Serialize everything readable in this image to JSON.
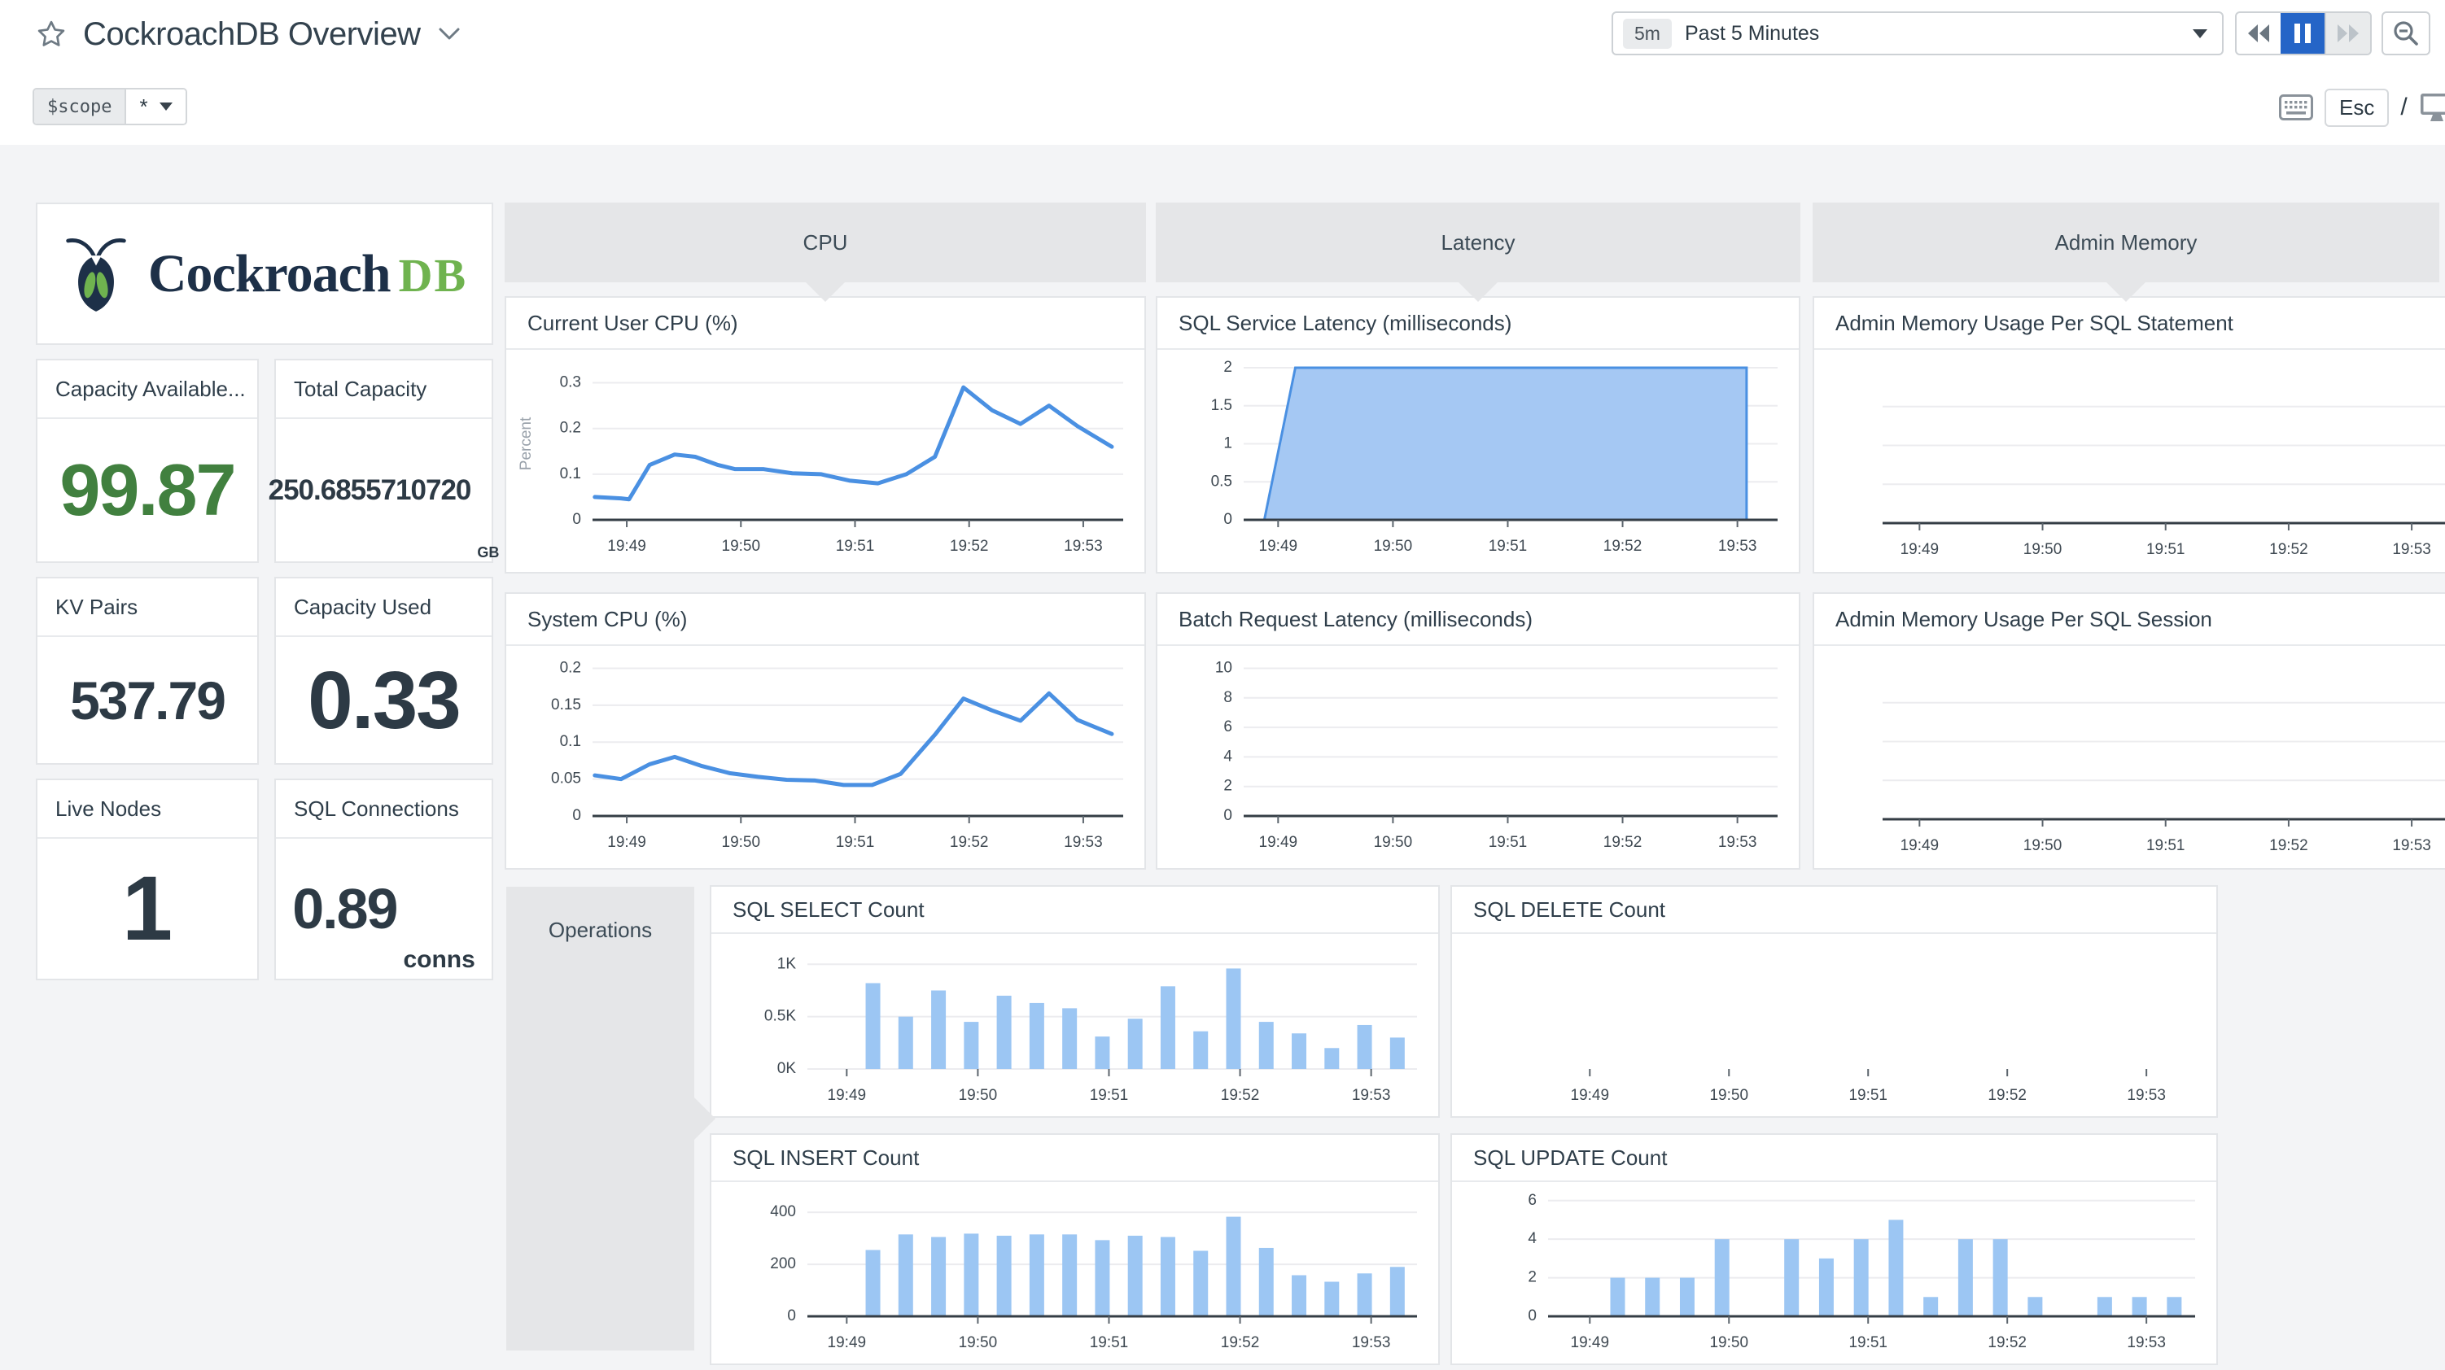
{
  "header": {
    "title": "CockroachDB Overview",
    "scope_label": "$scope",
    "scope_value": "*",
    "time_range_badge": "5m",
    "time_range_label": "Past 5 Minutes",
    "esc_label": "Esc",
    "slash": "/"
  },
  "logo": {
    "word": "Cockroach",
    "suffix": "DB"
  },
  "groups": {
    "cpu": "CPU",
    "latency": "Latency",
    "admin_memory": "Admin Memory",
    "operations": "Operations"
  },
  "metrics": [
    {
      "title": "Capacity Available...",
      "value": "99.87",
      "unit": "",
      "color": "#41803f"
    },
    {
      "title": "Total Capacity",
      "value": "250.6855710720",
      "unit": "GB",
      "color": "#2d3a45"
    },
    {
      "title": "KV Pairs",
      "value": "537.79",
      "unit": "",
      "color": "#2d3a45"
    },
    {
      "title": "Capacity Used",
      "value": "0.33",
      "unit": "",
      "color": "#2d3a45"
    },
    {
      "title": "Live Nodes",
      "value": "1",
      "unit": "",
      "color": "#2d3a45"
    },
    {
      "title": "SQL Connections",
      "value": "0.89",
      "unit": "conns",
      "color": "#2d3a45"
    }
  ],
  "theme": {
    "line": "#4a90e2",
    "area_fill": "#a5c8f3",
    "bar": "#9cc6f3",
    "grid": "#ececef",
    "axis": "#343d45",
    "tick_mark": "#5c656d",
    "tick_text": "#3f4952",
    "muted_label": "#9aa2ab",
    "accent_blue": "#2565c7",
    "value_green": "#41803f"
  },
  "time_axis": {
    "domain": [
      48.7,
      53.35
    ],
    "ticks": [
      {
        "v": 49,
        "label": "19:49"
      },
      {
        "v": 50,
        "label": "19:50"
      },
      {
        "v": 51,
        "label": "19:51"
      },
      {
        "v": 52,
        "label": "19:52"
      },
      {
        "v": 53,
        "label": "19:53"
      }
    ]
  },
  "chart_data": [
    {
      "type": "line",
      "title": "Current User CPU (%)",
      "ylabel": "Percent",
      "ylim": [
        0,
        0.333
      ],
      "y_ticks": [
        {
          "v": 0,
          "label": "0"
        },
        {
          "v": 0.1,
          "label": "0.1"
        },
        {
          "v": 0.2,
          "label": "0.2"
        },
        {
          "v": 0.3,
          "label": "0.3"
        }
      ],
      "axis": "dark",
      "points": [
        [
          48.72,
          0.05
        ],
        [
          48.95,
          0.047
        ],
        [
          49.02,
          0.045
        ],
        [
          49.2,
          0.12
        ],
        [
          49.42,
          0.143
        ],
        [
          49.6,
          0.138
        ],
        [
          49.8,
          0.12
        ],
        [
          49.95,
          0.111
        ],
        [
          50.2,
          0.111
        ],
        [
          50.45,
          0.102
        ],
        [
          50.7,
          0.1
        ],
        [
          50.95,
          0.086
        ],
        [
          51.2,
          0.08
        ],
        [
          51.45,
          0.1
        ],
        [
          51.7,
          0.138
        ],
        [
          51.95,
          0.29
        ],
        [
          52.2,
          0.24
        ],
        [
          52.45,
          0.21
        ],
        [
          52.7,
          0.25
        ],
        [
          52.95,
          0.205
        ],
        [
          53.25,
          0.16
        ]
      ]
    },
    {
      "type": "line",
      "title": "System CPU (%)",
      "ylabel": "",
      "ylim": [
        0,
        0.206
      ],
      "y_ticks": [
        {
          "v": 0,
          "label": "0"
        },
        {
          "v": 0.05,
          "label": "0.05"
        },
        {
          "v": 0.1,
          "label": "0.1"
        },
        {
          "v": 0.15,
          "label": "0.15"
        },
        {
          "v": 0.2,
          "label": "0.2"
        }
      ],
      "axis": "dark",
      "points": [
        [
          48.72,
          0.055
        ],
        [
          48.95,
          0.05
        ],
        [
          49.2,
          0.07
        ],
        [
          49.42,
          0.08
        ],
        [
          49.65,
          0.068
        ],
        [
          49.9,
          0.058
        ],
        [
          50.15,
          0.053
        ],
        [
          50.4,
          0.049
        ],
        [
          50.65,
          0.048
        ],
        [
          50.9,
          0.042
        ],
        [
          51.15,
          0.042
        ],
        [
          51.4,
          0.057
        ],
        [
          51.7,
          0.11
        ],
        [
          51.95,
          0.159
        ],
        [
          52.2,
          0.143
        ],
        [
          52.45,
          0.129
        ],
        [
          52.7,
          0.166
        ],
        [
          52.95,
          0.13
        ],
        [
          53.25,
          0.111
        ]
      ]
    },
    {
      "type": "area",
      "title": "SQL Service Latency (milliseconds)",
      "ylabel": "",
      "ylim": [
        0,
        2
      ],
      "y_ticks": [
        {
          "v": 0,
          "label": "0"
        },
        {
          "v": 0.5,
          "label": "0.5"
        },
        {
          "v": 1,
          "label": "1"
        },
        {
          "v": 1.5,
          "label": "1.5"
        },
        {
          "v": 2,
          "label": "2"
        }
      ],
      "axis": "dark",
      "points": [
        [
          48.88,
          0
        ],
        [
          49.15,
          2
        ],
        [
          53.08,
          2
        ],
        [
          53.08,
          0
        ]
      ]
    },
    {
      "type": "line",
      "title": "Batch Request Latency (milliseconds)",
      "ylabel": "",
      "ylim": [
        0,
        10.3
      ],
      "y_ticks": [
        {
          "v": 0,
          "label": "0"
        },
        {
          "v": 2,
          "label": "2"
        },
        {
          "v": 4,
          "label": "4"
        },
        {
          "v": 6,
          "label": "6"
        },
        {
          "v": 8,
          "label": "8"
        },
        {
          "v": 10,
          "label": "10"
        }
      ],
      "axis": "dark",
      "points": []
    },
    {
      "type": "line",
      "title": "Admin Memory Usage Per SQL Statement",
      "ylabel": "",
      "ylim": [
        0,
        4
      ],
      "y_ticks": [
        {
          "v": 1,
          "label": ""
        },
        {
          "v": 2,
          "label": ""
        },
        {
          "v": 3,
          "label": ""
        }
      ],
      "axis": "dark",
      "points": []
    },
    {
      "type": "line",
      "title": "Admin Memory Usage Per SQL Session",
      "ylabel": "",
      "ylim": [
        0,
        4
      ],
      "y_ticks": [
        {
          "v": 1,
          "label": ""
        },
        {
          "v": 2,
          "label": ""
        },
        {
          "v": 3,
          "label": ""
        }
      ],
      "axis": "dark",
      "points": []
    },
    {
      "type": "bar",
      "title": "SQL SELECT Count",
      "ylabel": "",
      "ylim": [
        0,
        1150
      ],
      "y_ticks": [
        {
          "v": 0,
          "label": "0K"
        },
        {
          "v": 500,
          "label": "0.5K"
        },
        {
          "v": 1000,
          "label": "1K"
        }
      ],
      "axis": "light",
      "x": [
        49.2,
        49.45,
        49.7,
        49.95,
        50.2,
        50.45,
        50.7,
        50.95,
        51.2,
        51.45,
        51.7,
        51.95,
        52.2,
        52.45,
        52.7,
        52.95,
        53.2
      ],
      "values": [
        820,
        500,
        750,
        450,
        700,
        630,
        580,
        310,
        480,
        790,
        360,
        960,
        450,
        340,
        200,
        420,
        300
      ]
    },
    {
      "type": "bar",
      "title": "SQL DELETE Count",
      "ylabel": "",
      "ylim": [
        0,
        1
      ],
      "y_ticks": [],
      "axis": "none",
      "x": [],
      "values": []
    },
    {
      "type": "bar",
      "title": "SQL INSERT Count",
      "ylabel": "",
      "ylim": [
        0,
        460
      ],
      "y_ticks": [
        {
          "v": 0,
          "label": "0"
        },
        {
          "v": 200,
          "label": "200"
        },
        {
          "v": 400,
          "label": "400"
        }
      ],
      "axis": "dark",
      "x": [
        49.2,
        49.45,
        49.7,
        49.95,
        50.2,
        50.45,
        50.7,
        50.95,
        51.2,
        51.45,
        51.7,
        51.95,
        52.2,
        52.45,
        52.7,
        52.95,
        53.2
      ],
      "values": [
        255,
        315,
        305,
        318,
        310,
        315,
        315,
        293,
        310,
        305,
        252,
        383,
        263,
        158,
        133,
        165,
        190
      ]
    },
    {
      "type": "bar",
      "title": "SQL UPDATE Count",
      "ylabel": "",
      "ylim": [
        0,
        6.2
      ],
      "y_ticks": [
        {
          "v": 0,
          "label": "0"
        },
        {
          "v": 2,
          "label": "2"
        },
        {
          "v": 4,
          "label": "4"
        },
        {
          "v": 6,
          "label": "6"
        }
      ],
      "axis": "dark",
      "x": [
        49.2,
        49.45,
        49.7,
        49.95,
        50.2,
        50.45,
        50.7,
        50.95,
        51.2,
        51.45,
        51.7,
        51.95,
        52.2,
        52.45,
        52.7,
        52.95,
        53.2
      ],
      "values": [
        2,
        2,
        2,
        4,
        0,
        4,
        3,
        4,
        5,
        1,
        4,
        4,
        1,
        0,
        1,
        1,
        1
      ]
    }
  ]
}
